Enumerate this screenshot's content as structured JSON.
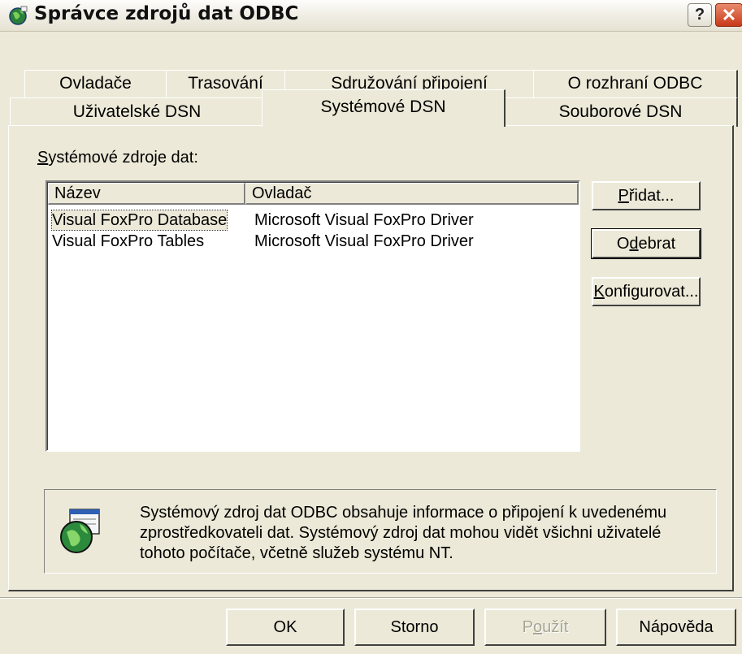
{
  "window": {
    "title": "Správce zdrojů dat ODBC",
    "help_label": "?",
    "close_label": "✕"
  },
  "tabs": {
    "row1": [
      "Ovladače",
      "Trasování",
      "Sdružování připojení",
      "O rozhraní ODBC"
    ],
    "row2": [
      "Uživatelské DSN",
      "Systémové DSN",
      "Souborové DSN"
    ],
    "active": "Systémové DSN"
  },
  "system_sources": {
    "label_accel": "S",
    "label_rest": "ystémové zdroje dat:",
    "columns": [
      "Název",
      "Ovladač"
    ],
    "rows": [
      {
        "name": "Visual FoxPro Database",
        "driver": "Microsoft Visual FoxPro Driver",
        "selected": true
      },
      {
        "name": "Visual FoxPro Tables",
        "driver": "Microsoft Visual FoxPro Driver",
        "selected": false
      }
    ]
  },
  "side_buttons": {
    "add": {
      "accel": "P",
      "rest": "řidat..."
    },
    "remove": {
      "pre": "O",
      "accel": "d",
      "rest": "ebrat"
    },
    "configure": {
      "accel": "K",
      "rest": "onfigurovat..."
    }
  },
  "info": {
    "lines": [
      "Systémový zdroj dat ODBC obsahuje informace o připojení k uvedenému",
      "zprostředkovateli dat. Systémový zdroj dat mohou vidět všichni uživatelé",
      "tohoto počítače, včetně služeb systému NT."
    ]
  },
  "bottom_buttons": {
    "ok": "OK",
    "cancel": "Storno",
    "apply": {
      "pre": "P",
      "accel": "o",
      "rest": "užít"
    },
    "help": "Nápověda"
  },
  "colors": {
    "dialog_face": "#ece9d8",
    "close_red": "#c8391a",
    "disabled_text": "#a7a493"
  }
}
